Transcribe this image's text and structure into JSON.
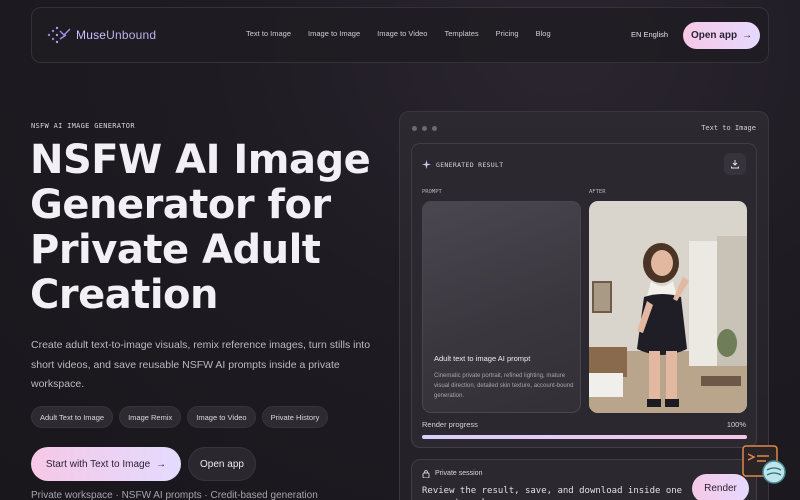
{
  "brand": {
    "name": "Muse",
    "name_suffix": "Unbound"
  },
  "nav": {
    "links": [
      "Text to Image",
      "Image to Image",
      "Image to Video",
      "Templates",
      "Pricing",
      "Blog"
    ],
    "language": "EN English",
    "open_app": "Open app"
  },
  "hero": {
    "eyebrow": "NSFW AI IMAGE GENERATOR",
    "title": "NSFW AI Image Generator for Private Adult Creation",
    "description": "Create adult text-to-image visuals, remix reference images, turn stills into short videos, and save reusable NSFW AI prompts inside a private workspace.",
    "chips": [
      "Adult Text to Image",
      "Image Remix",
      "Image to Video",
      "Private History"
    ],
    "cta_primary": "Start with Text to Image",
    "cta_secondary": "Open app",
    "footnote": "Private workspace · NSFW AI prompts · Credit-based generation"
  },
  "panel": {
    "mode_label": "Text to Image",
    "result_title": "GENERATED RESULT",
    "prompt_label": "PROMPT",
    "after_label": "AFTER",
    "prompt_title": "Adult text to image AI prompt",
    "prompt_text": "Cinematic private portrait, refined lighting, mature visual direction, detailed skin texture, account-bound generation.",
    "progress_label": "Render progress",
    "progress_value": "100%",
    "progress_fraction": 1.0,
    "session_title": "Private session",
    "session_text": "Review the result, save, and download inside one account workspace.",
    "render_button": "Render"
  },
  "colors": {
    "accent_start": "#f6c8e6",
    "accent_end": "#e4dbff",
    "background": "#1e1b22"
  },
  "icons": [
    "logo-mark-icon",
    "arrow-right-icon",
    "sparkle-icon",
    "download-icon",
    "lock-icon",
    "chat-badge-icon"
  ]
}
